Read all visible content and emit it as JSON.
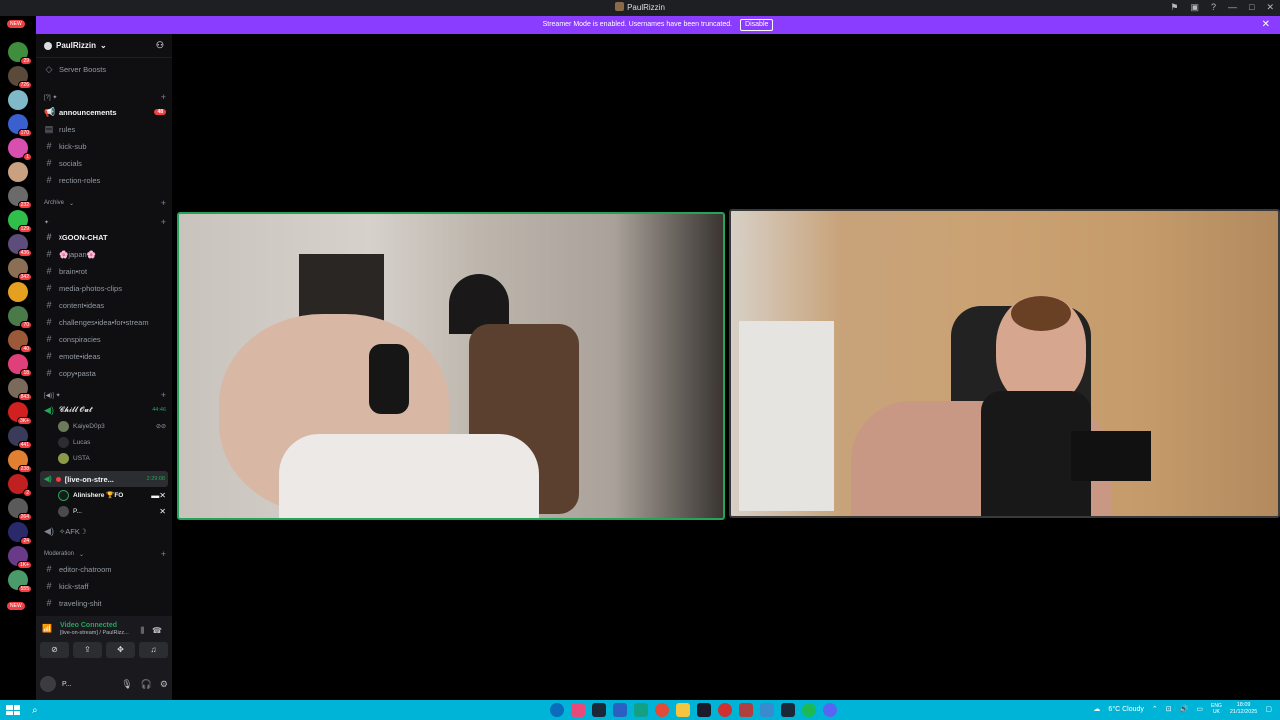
{
  "window": {
    "title": "PaulRizzin",
    "controls": [
      "minimize",
      "maximize",
      "close"
    ]
  },
  "banner": {
    "text": "Streamer Mode is enabled. Usernames have been truncated.",
    "button": "Disable"
  },
  "servers": {
    "new_top": "NEW",
    "new_bottom": "NEW",
    "badges": [
      "29",
      "726",
      "1",
      "170",
      "1",
      "232",
      "129",
      "436",
      "342",
      "98",
      "70",
      "40",
      "18",
      "843",
      "3K+",
      "441",
      "238",
      "2",
      "264",
      "24",
      "1K+",
      "555",
      "1K+"
    ]
  },
  "guild": {
    "name": "PaulRizzin"
  },
  "sidebar": {
    "boosts": "Server Boosts",
    "cat1": "[?] ✦",
    "channels1": [
      {
        "name": "announcements",
        "count": "48",
        "bold": true
      },
      {
        "name": "rules"
      },
      {
        "name": "kick-sub"
      },
      {
        "name": "socials"
      },
      {
        "name": "rection-roles"
      }
    ],
    "archive": "Archive",
    "cat2": "✦",
    "channels2": [
      "ᵡGOON-CHAT",
      "🌸japan🌸",
      "brain•rot",
      "media-photos-clips",
      "content•ideas",
      "challenges•idea•for•stream",
      "conspiracies",
      "emote•ideas",
      "copy•pasta"
    ],
    "cat3": "[◀)] ✦",
    "chill": {
      "name": "𝓒𝓱𝓲𝓵𝓵 𝓞𝓾𝓽",
      "time": "44:46"
    },
    "chill_users": [
      "KaiyeD0p3",
      "Lucas",
      "USTA"
    ],
    "live": {
      "name": "[live-on-stre...",
      "time": "2:29:08"
    },
    "live_users": [
      "Alinishere 🏆FO",
      "P..."
    ],
    "afk": "✧AFK☽",
    "moderation": "Moderation",
    "mod_channels": [
      "editor-chatroom",
      "kick-staff",
      "traveling-shit"
    ]
  },
  "panel": {
    "status": "Video Connected",
    "sub": "[live-on-stream] / PaulRizz...",
    "user": "P..."
  },
  "taskbar": {
    "weather": "6°C Cloudy",
    "lang1": "ENG",
    "lang2": "UK",
    "time": "18:09",
    "date": "21/12/2025"
  }
}
